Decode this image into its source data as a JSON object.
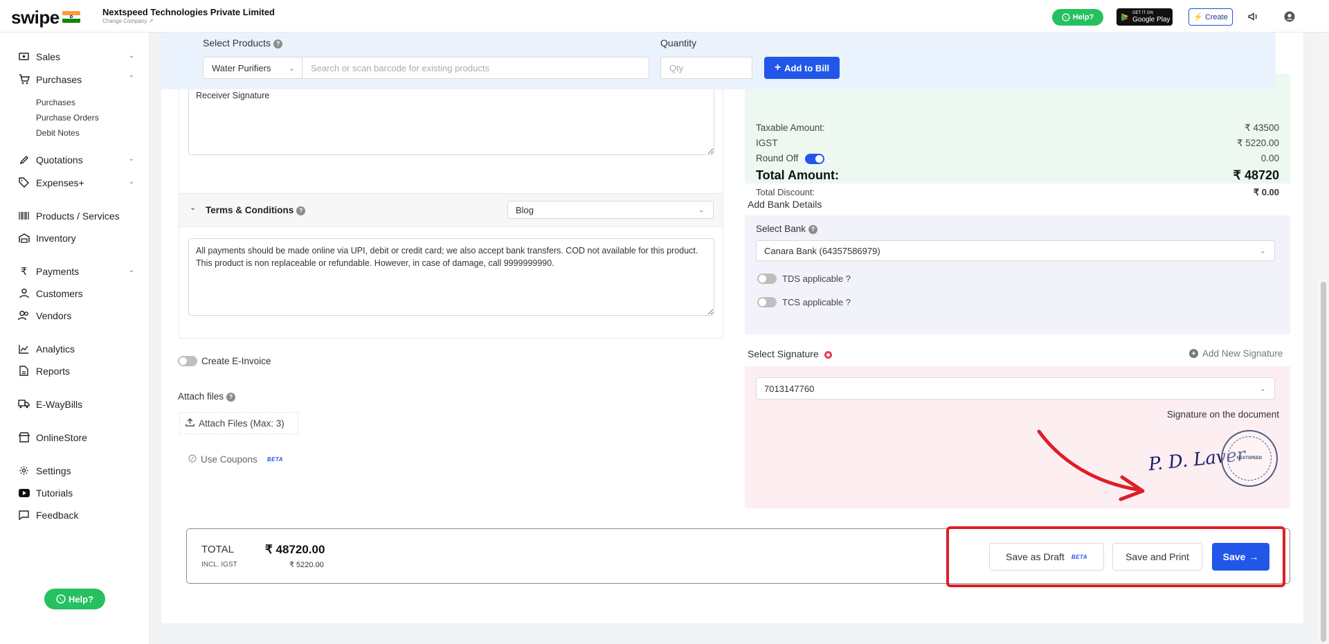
{
  "header": {
    "logo_text": "swipe",
    "company_name": "Nextspeed Technologies Private Limited",
    "change_company": "Change Company ↗",
    "help_label": "Help?",
    "google_play_small": "GET IT ON",
    "google_play_label": "Google Play",
    "create_label": "Create"
  },
  "sidebar": {
    "items": [
      {
        "label": "Sales"
      },
      {
        "label": "Purchases"
      },
      {
        "label": "Quotations"
      },
      {
        "label": "Expenses+"
      },
      {
        "label": "Products / Services"
      },
      {
        "label": "Inventory"
      },
      {
        "label": "Payments"
      },
      {
        "label": "Customers"
      },
      {
        "label": "Vendors"
      },
      {
        "label": "Analytics"
      },
      {
        "label": "Reports"
      },
      {
        "label": "E-WayBills"
      },
      {
        "label": "OnlineStore"
      },
      {
        "label": "Settings"
      },
      {
        "label": "Tutorials"
      },
      {
        "label": "Feedback"
      }
    ],
    "purchases_sub": [
      "Purchases",
      "Purchase Orders",
      "Debit Notes"
    ],
    "help_label": "Help?"
  },
  "products": {
    "title": "Select Products",
    "category": "Water Purifiers",
    "search_placeholder": "Search or scan barcode for existing products",
    "quantity_label": "Quantity",
    "qty_placeholder": "Qty",
    "add_button": "Add to Bill"
  },
  "notes": {
    "receiver_text": "Receiver Signature"
  },
  "terms": {
    "title": "Terms & Conditions",
    "template": "Blog",
    "text": "All payments should be made online via UPI, debit or credit card; we also accept bank transfers. COD not available for this product. This product is non replaceable or refundable. However, in case of damage, call 9999999990."
  },
  "einvoice_label": "Create E-Invoice",
  "attach": {
    "label": "Attach files",
    "button": "Attach Files (Max: 3)"
  },
  "coupons": {
    "label": "Use Coupons",
    "beta": "BETA"
  },
  "totals": {
    "taxable_label": "Taxable Amount:",
    "taxable_value": "₹ 43500",
    "igst_label": "IGST",
    "igst_value": "₹ 5220.00",
    "roundoff_label": "Round Off",
    "roundoff_value": "0.00",
    "total_label": "Total Amount:",
    "total_value": "₹ 48720",
    "discount_label": "Total Discount:",
    "discount_value": "₹ 0.00"
  },
  "bank": {
    "section_title": "Add Bank Details",
    "select_label": "Select Bank",
    "selected": "Canara Bank (64357586979)",
    "tds_label": "TDS applicable ?",
    "tcs_label": "TCS applicable ?"
  },
  "signature": {
    "section_title": "Select Signature",
    "add_new": "Add New Signature",
    "selected": "7013147760",
    "on_doc_label": "Signature on the document",
    "handwritten": "P. D. Laver",
    "stamp_text": "NEXTSPEED"
  },
  "footer": {
    "total_label": "TOTAL",
    "total_value": "₹ 48720.00",
    "incl_label": "INCL. IGST",
    "incl_value": "₹ 5220.00",
    "draft_label": "Save as Draft",
    "draft_beta": "BETA",
    "print_label": "Save and Print",
    "save_label": "Save"
  },
  "colors": {
    "primary": "#2156e9",
    "whatsapp": "#25c05f",
    "annotation_red": "#dc1f26",
    "totals_bg": "#edf8f1",
    "signature_bg": "#fdeef2",
    "products_bg": "#eaf3fd"
  }
}
